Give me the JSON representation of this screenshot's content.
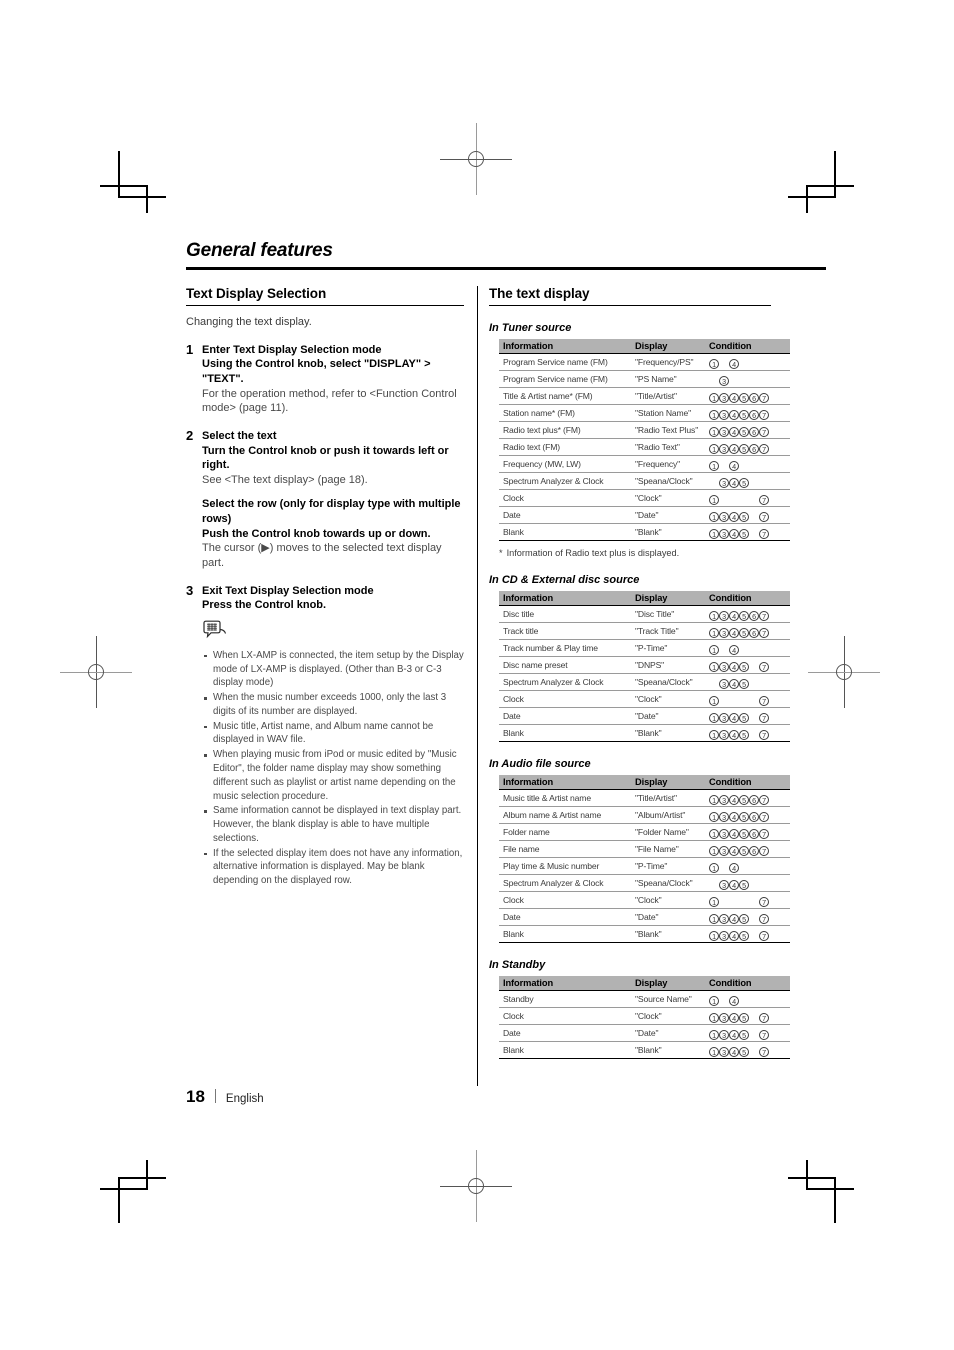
{
  "chapter": {
    "title": "General features"
  },
  "left": {
    "heading": "Text Display Selection",
    "lead": "Changing the text display.",
    "steps": [
      {
        "num": "1",
        "bold1": "Enter Text Display Selection mode",
        "bold2": "Using the Control knob, select \"DISPLAY\" > \"TEXT\".",
        "normal": "For the operation method, refer to <Function Control mode> (page 11)."
      },
      {
        "num": "2",
        "bold1": "Select the text",
        "bold2": "Turn the Control knob or push it towards left or right.",
        "normal": "See <The text display> (page 18).",
        "bold3": "Select the row (only for display type with multiple rows)",
        "bold4": "Push the Control knob towards up or down.",
        "normal2": "The cursor (▶) moves to the selected text display part."
      },
      {
        "num": "3",
        "bold1": "Exit Text Display Selection mode",
        "bold2": "Press the Control knob."
      }
    ],
    "note_icon": "note-bubble-icon",
    "notes": [
      "When LX-AMP is connected, the item setup by the Display mode of LX-AMP is displayed. (Other than B-3 or C-3 display mode)",
      "When the music number exceeds 1000, only the last 3 digits of its number are displayed.",
      "Music title, Artist name, and Album name cannot be displayed in WAV file.",
      "When playing music from iPod or music edited by \"Music Editor\", the folder name display may show something different such as playlist or artist name depending on the music selection procedure.",
      "Same information cannot be displayed in text display part. However, the blank display is able to have multiple selections.",
      "If the selected display item does not have any information, alternative information is displayed. May be blank depending on the displayed row."
    ]
  },
  "right": {
    "heading": "The text display",
    "columns": [
      "Information",
      "Display",
      "Condition"
    ],
    "tables": [
      {
        "title": "In Tuner source",
        "rows": [
          {
            "info": "Program Service name (FM)",
            "display": "\"Frequency/PS\"",
            "cond": [
              "1",
              "",
              "4",
              "",
              "",
              ""
            ]
          },
          {
            "info": "Program Service name (FM)",
            "display": "\"PS Name\"",
            "cond": [
              "",
              "3",
              "",
              "",
              "",
              ""
            ]
          },
          {
            "info": "Title & Artist name* (FM)",
            "display": "\"Title/Artist\"",
            "cond": [
              "1",
              "3",
              "4",
              "5",
              "6",
              "7"
            ]
          },
          {
            "info": "Station name* (FM)",
            "display": "\"Station Name\"",
            "cond": [
              "1",
              "3",
              "4",
              "5",
              "6",
              "7"
            ]
          },
          {
            "info": "Radio text plus* (FM)",
            "display": "\"Radio Text Plus\"",
            "cond": [
              "1",
              "3",
              "4",
              "5",
              "6",
              "7"
            ]
          },
          {
            "info": "Radio text (FM)",
            "display": "\"Radio Text\"",
            "cond": [
              "1",
              "3",
              "4",
              "5",
              "6",
              "7"
            ]
          },
          {
            "info": "Frequency (MW, LW)",
            "display": "\"Frequency\"",
            "cond": [
              "1",
              "",
              "4",
              "",
              "",
              ""
            ]
          },
          {
            "info": "Spectrum Analyzer & Clock",
            "display": "\"Speana/Clock\"",
            "cond": [
              "",
              "3",
              "4",
              "5",
              "",
              ""
            ]
          },
          {
            "info": "Clock",
            "display": "\"Clock\"",
            "cond": [
              "1",
              "",
              "",
              "",
              "",
              "7"
            ]
          },
          {
            "info": "Date",
            "display": "\"Date\"",
            "cond": [
              "1",
              "3",
              "4",
              "5",
              "",
              "7"
            ]
          },
          {
            "info": "Blank",
            "display": "\"Blank\"",
            "cond": [
              "1",
              "3",
              "4",
              "5",
              "",
              "7"
            ]
          }
        ],
        "footnote": "Information of Radio text plus is displayed.",
        "footnote_marker": "*"
      },
      {
        "title": "In CD & External disc source",
        "rows": [
          {
            "info": "Disc title",
            "display": "\"Disc Title\"",
            "cond": [
              "1",
              "3",
              "4",
              "5",
              "6",
              "7"
            ]
          },
          {
            "info": "Track title",
            "display": "\"Track Title\"",
            "cond": [
              "1",
              "3",
              "4",
              "5",
              "6",
              "7"
            ]
          },
          {
            "info": "Track number & Play time",
            "display": "\"P-Time\"",
            "cond": [
              "1",
              "",
              "4",
              "",
              "",
              ""
            ]
          },
          {
            "info": "Disc name preset",
            "display": "\"DNPS\"",
            "cond": [
              "1",
              "3",
              "4",
              "5",
              "",
              "7"
            ]
          },
          {
            "info": "Spectrum Analyzer & Clock",
            "display": "\"Speana/Clock\"",
            "cond": [
              "",
              "3",
              "4",
              "5",
              "",
              ""
            ]
          },
          {
            "info": "Clock",
            "display": "\"Clock\"",
            "cond": [
              "1",
              "",
              "",
              "",
              "",
              "7"
            ]
          },
          {
            "info": "Date",
            "display": "\"Date\"",
            "cond": [
              "1",
              "3",
              "4",
              "5",
              "",
              "7"
            ]
          },
          {
            "info": "Blank",
            "display": "\"Blank\"",
            "cond": [
              "1",
              "3",
              "4",
              "5",
              "",
              "7"
            ]
          }
        ]
      },
      {
        "title": "In Audio file source",
        "rows": [
          {
            "info": "Music title & Artist name",
            "display": "\"Title/Artist\"",
            "cond": [
              "1",
              "3",
              "4",
              "5",
              "6",
              "7"
            ]
          },
          {
            "info": "Album name & Artist name",
            "display": "\"Album/Artist\"",
            "cond": [
              "1",
              "3",
              "4",
              "5",
              "6",
              "7"
            ]
          },
          {
            "info": "Folder name",
            "display": "\"Folder Name\"",
            "cond": [
              "1",
              "3",
              "4",
              "5",
              "6",
              "7"
            ]
          },
          {
            "info": "File name",
            "display": "\"File Name\"",
            "cond": [
              "1",
              "3",
              "4",
              "5",
              "6",
              "7"
            ]
          },
          {
            "info": "Play time & Music number",
            "display": "\"P-Time\"",
            "cond": [
              "1",
              "",
              "4",
              "",
              "",
              ""
            ]
          },
          {
            "info": "Spectrum Analyzer & Clock",
            "display": "\"Speana/Clock\"",
            "cond": [
              "",
              "3",
              "4",
              "5",
              "",
              ""
            ]
          },
          {
            "info": "Clock",
            "display": "\"Clock\"",
            "cond": [
              "1",
              "",
              "",
              "",
              "",
              "7"
            ]
          },
          {
            "info": "Date",
            "display": "\"Date\"",
            "cond": [
              "1",
              "3",
              "4",
              "5",
              "",
              "7"
            ]
          },
          {
            "info": "Blank",
            "display": "\"Blank\"",
            "cond": [
              "1",
              "3",
              "4",
              "5",
              "",
              "7"
            ]
          }
        ]
      },
      {
        "title": "In Standby",
        "rows": [
          {
            "info": "Standby",
            "display": "\"Source Name\"",
            "cond": [
              "1",
              "",
              "4",
              "",
              "",
              ""
            ]
          },
          {
            "info": "Clock",
            "display": "\"Clock\"",
            "cond": [
              "1",
              "3",
              "4",
              "5",
              "",
              "7"
            ]
          },
          {
            "info": "Date",
            "display": "\"Date\"",
            "cond": [
              "1",
              "3",
              "4",
              "5",
              "",
              "7"
            ]
          },
          {
            "info": "Blank",
            "display": "\"Blank\"",
            "cond": [
              "1",
              "3",
              "4",
              "5",
              "",
              "7"
            ]
          }
        ]
      }
    ]
  },
  "footer": {
    "page_number": "18",
    "language": "English"
  },
  "colors": {
    "header_bg": "#b2b2b2",
    "rule": "#000000",
    "body_text": "#3c3c3c"
  }
}
